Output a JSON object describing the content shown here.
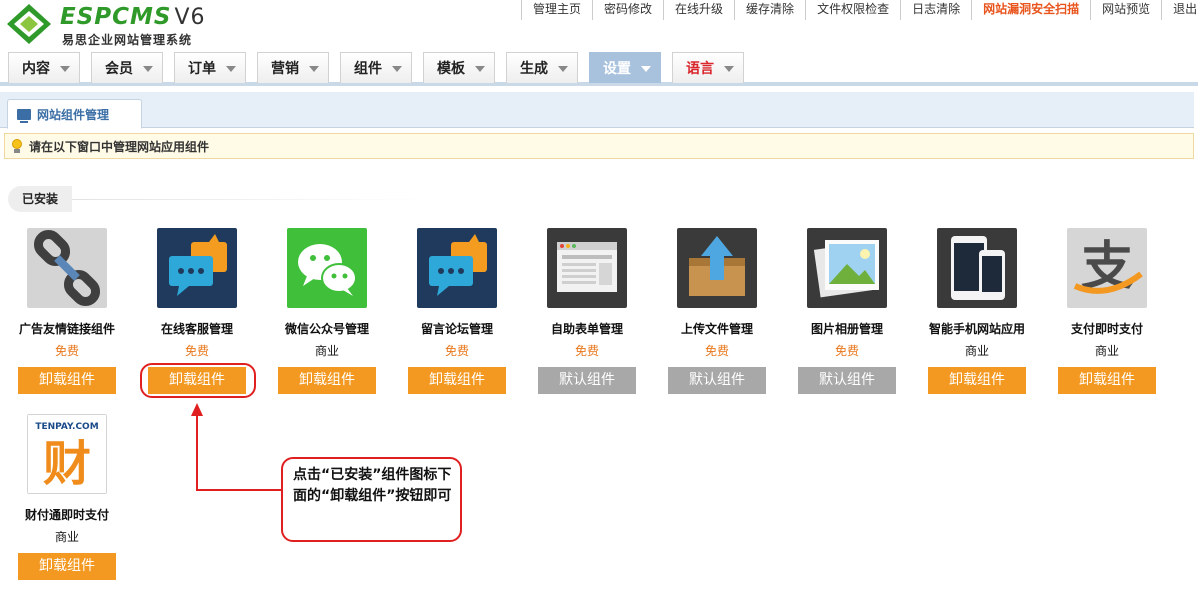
{
  "logo": {
    "brand": "ESPCMS",
    "version": "V6",
    "subtitle": "易思企业网站管理系统"
  },
  "top_links": [
    {
      "label": "管理主页",
      "highlight": false
    },
    {
      "label": "密码修改",
      "highlight": false
    },
    {
      "label": "在线升级",
      "highlight": false
    },
    {
      "label": "缓存清除",
      "highlight": false
    },
    {
      "label": "文件权限检查",
      "highlight": false
    },
    {
      "label": "日志清除",
      "highlight": false
    },
    {
      "label": "网站漏洞安全扫描",
      "highlight": true
    },
    {
      "label": "网站预览",
      "highlight": false
    },
    {
      "label": "退出",
      "highlight": false
    }
  ],
  "menu": [
    {
      "label": "内容"
    },
    {
      "label": "会员"
    },
    {
      "label": "订单"
    },
    {
      "label": "营销"
    },
    {
      "label": "组件"
    },
    {
      "label": "模板"
    },
    {
      "label": "生成"
    },
    {
      "label": "设置",
      "active": true
    },
    {
      "label": "语言",
      "red": true
    }
  ],
  "tab": {
    "label": "网站组件管理",
    "icon": "monitor-icon"
  },
  "notice": {
    "text": "请在以下窗口中管理网站应用组件",
    "icon": "lightbulb-icon"
  },
  "section": {
    "label": "已安装"
  },
  "plugins": [
    {
      "name": "广告友情链接组件",
      "price": "免费",
      "free": true,
      "button": "卸载组件",
      "button_type": "uninstall",
      "icon": "chain-link-icon"
    },
    {
      "name": "在线客服管理",
      "price": "免费",
      "free": true,
      "button": "卸载组件",
      "button_type": "uninstall",
      "icon": "chat-bubbles-icon"
    },
    {
      "name": "微信公众号管理",
      "price": "商业",
      "free": false,
      "button": "卸载组件",
      "button_type": "uninstall",
      "icon": "wechat-icon"
    },
    {
      "name": "留言论坛管理",
      "price": "免费",
      "free": true,
      "button": "卸载组件",
      "button_type": "uninstall",
      "icon": "chat-bubbles-icon"
    },
    {
      "name": "自助表单管理",
      "price": "免费",
      "free": true,
      "button": "默认组件",
      "button_type": "default",
      "icon": "browser-form-icon"
    },
    {
      "name": "上传文件管理",
      "price": "免费",
      "free": true,
      "button": "默认组件",
      "button_type": "default",
      "icon": "upload-box-icon"
    },
    {
      "name": "图片相册管理",
      "price": "免费",
      "free": true,
      "button": "默认组件",
      "button_type": "default",
      "icon": "photo-album-icon"
    },
    {
      "name": "智能手机网站应用",
      "price": "商业",
      "free": false,
      "button": "卸载组件",
      "button_type": "uninstall",
      "icon": "smartphone-icon"
    },
    {
      "name": "支付即时支付",
      "price": "商业",
      "free": false,
      "button": "卸载组件",
      "button_type": "uninstall",
      "icon": "alipay-icon"
    },
    {
      "name": "财付通即时支付",
      "price": "商业",
      "free": false,
      "button": "卸载组件",
      "button_type": "uninstall",
      "icon": "tenpay-icon",
      "icon_text": "TENPAY.COM",
      "icon_glyph": "财"
    }
  ],
  "annotation": {
    "text": "点击“已安装”组件图标下面的“卸载组件”按钮即可",
    "color": "#e02020"
  },
  "colors": {
    "accent_orange": "#f39820",
    "default_gray": "#a8a8a8",
    "brand_green": "#2f9a2a",
    "active_menu": "#a8c2de",
    "free_text": "#e8771c"
  }
}
